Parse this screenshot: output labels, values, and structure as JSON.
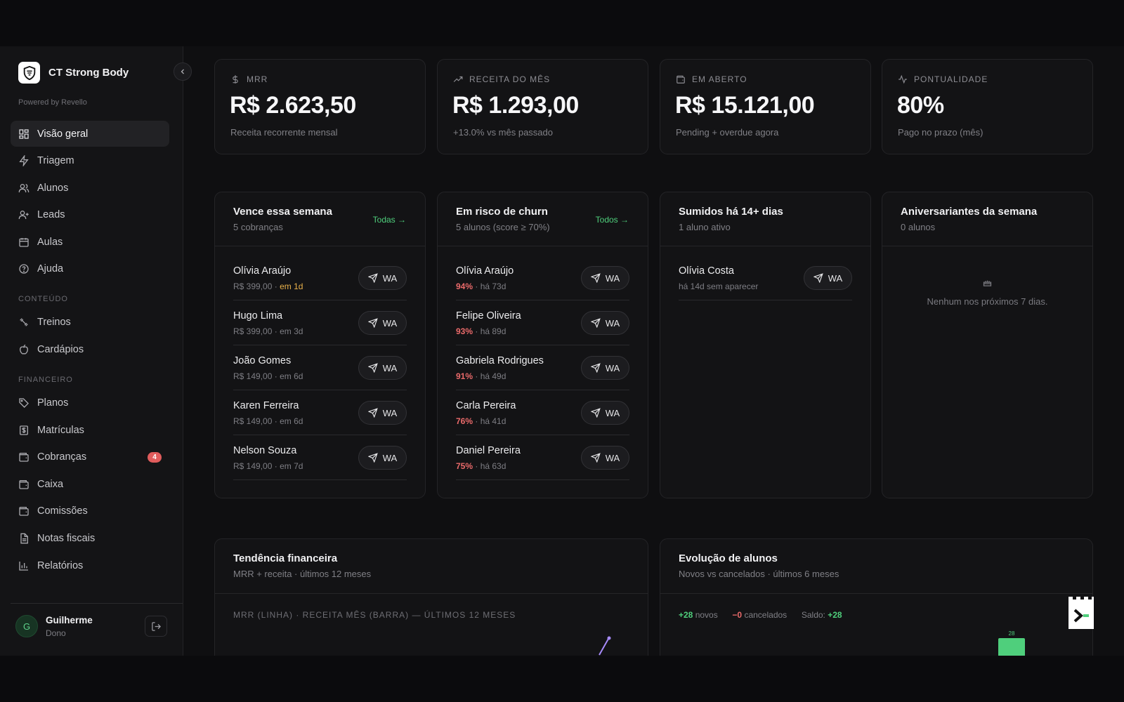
{
  "brand": {
    "name": "CT Strong Body",
    "powered": "Powered by Revello"
  },
  "nav": {
    "main": [
      {
        "label": "Visão geral",
        "icon": "grid-icon",
        "active": true
      },
      {
        "label": "Triagem",
        "icon": "bolt-icon"
      },
      {
        "label": "Alunos",
        "icon": "users-icon"
      },
      {
        "label": "Leads",
        "icon": "user-plus-icon"
      },
      {
        "label": "Aulas",
        "icon": "calendar-icon"
      },
      {
        "label": "Ajuda",
        "icon": "help-icon"
      }
    ],
    "conteudo_label": "CONTEÚDO",
    "conteudo": [
      {
        "label": "Treinos",
        "icon": "dumbbell-icon"
      },
      {
        "label": "Cardápios",
        "icon": "apple-icon"
      }
    ],
    "financeiro_label": "FINANCEIRO",
    "financeiro": [
      {
        "label": "Planos",
        "icon": "tag-icon"
      },
      {
        "label": "Matrículas",
        "icon": "receipt-icon"
      },
      {
        "label": "Cobranças",
        "icon": "wallet-icon",
        "badge": "4"
      },
      {
        "label": "Caixa",
        "icon": "wallet-icon"
      },
      {
        "label": "Comissões",
        "icon": "wallet-icon"
      },
      {
        "label": "Notas fiscais",
        "icon": "file-icon"
      },
      {
        "label": "Relatórios",
        "icon": "bar-chart-icon"
      }
    ]
  },
  "user": {
    "initial": "G",
    "name": "Guilherme",
    "role": "Dono"
  },
  "kpis": [
    {
      "label": "MRR",
      "value": "R$ 2.623,50",
      "sub": "Receita recorrente mensal",
      "icon": "dollar-icon"
    },
    {
      "label": "RECEITA DO MÊS",
      "value": "R$ 1.293,00",
      "sub": "+13.0% vs mês passado",
      "icon": "trend-up-icon"
    },
    {
      "label": "EM ABERTO",
      "value": "R$ 15.121,00",
      "sub": "Pending + overdue agora",
      "icon": "wallet-icon"
    },
    {
      "label": "PONTUALIDADE",
      "value": "80%",
      "sub": "Pago no prazo (mês)",
      "icon": "activity-icon"
    }
  ],
  "vence": {
    "title": "Vence essa semana",
    "sub": "5 cobranças",
    "link": "Todas →",
    "rows": [
      {
        "name": "Olívia Araújo",
        "amount": "R$ 399,00",
        "due": "em 1d",
        "warn": true
      },
      {
        "name": "Hugo Lima",
        "amount": "R$ 399,00",
        "due": "em 3d"
      },
      {
        "name": "João Gomes",
        "amount": "R$ 149,00",
        "due": "em 6d"
      },
      {
        "name": "Karen Ferreira",
        "amount": "R$ 149,00",
        "due": "em 6d"
      },
      {
        "name": "Nelson Souza",
        "amount": "R$ 149,00",
        "due": "em 7d"
      }
    ]
  },
  "churn": {
    "title": "Em risco de churn",
    "sub": "5 alunos (score ≥ 70%)",
    "link": "Todos →",
    "rows": [
      {
        "name": "Olívia Araújo",
        "score": "94%",
        "since": "há 73d"
      },
      {
        "name": "Felipe Oliveira",
        "score": "93%",
        "since": "há 89d"
      },
      {
        "name": "Gabriela Rodrigues",
        "score": "91%",
        "since": "há 49d"
      },
      {
        "name": "Carla Pereira",
        "score": "76%",
        "since": "há 41d"
      },
      {
        "name": "Daniel Pereira",
        "score": "75%",
        "since": "há 63d"
      }
    ]
  },
  "sumidos": {
    "title": "Sumidos há 14+ dias",
    "sub": "1 aluno ativo",
    "rows": [
      {
        "name": "Olívia Costa",
        "meta": "há 14d sem aparecer"
      }
    ]
  },
  "aniversariantes": {
    "title": "Aniversariantes da semana",
    "sub": "0 alunos",
    "empty": "Nenhum nos próximos 7 dias.",
    "icon": "cake-icon"
  },
  "wa_label": "WA",
  "tendencia": {
    "title": "Tendência financeira",
    "sub": "MRR + receita · últimos 12 meses",
    "caption": "MRR (LINHA) · RECEITA MÊS (BARRA) — ÚLTIMOS 12 MESES"
  },
  "evolucao": {
    "title": "Evolução de alunos",
    "sub": "Novos vs cancelados · últimos 6 meses",
    "novos_value": "+28",
    "novos_label": "novos",
    "cancel_value": "−0",
    "cancel_label": "cancelados",
    "saldo_label": "Saldo:",
    "saldo_value": "+28",
    "bar_label": "28"
  },
  "colors": {
    "accent_green": "#4fcf7c",
    "risk_red": "#ea6a6a",
    "warn_yellow": "#e8b04a",
    "line_purple": "#a78bfa"
  }
}
